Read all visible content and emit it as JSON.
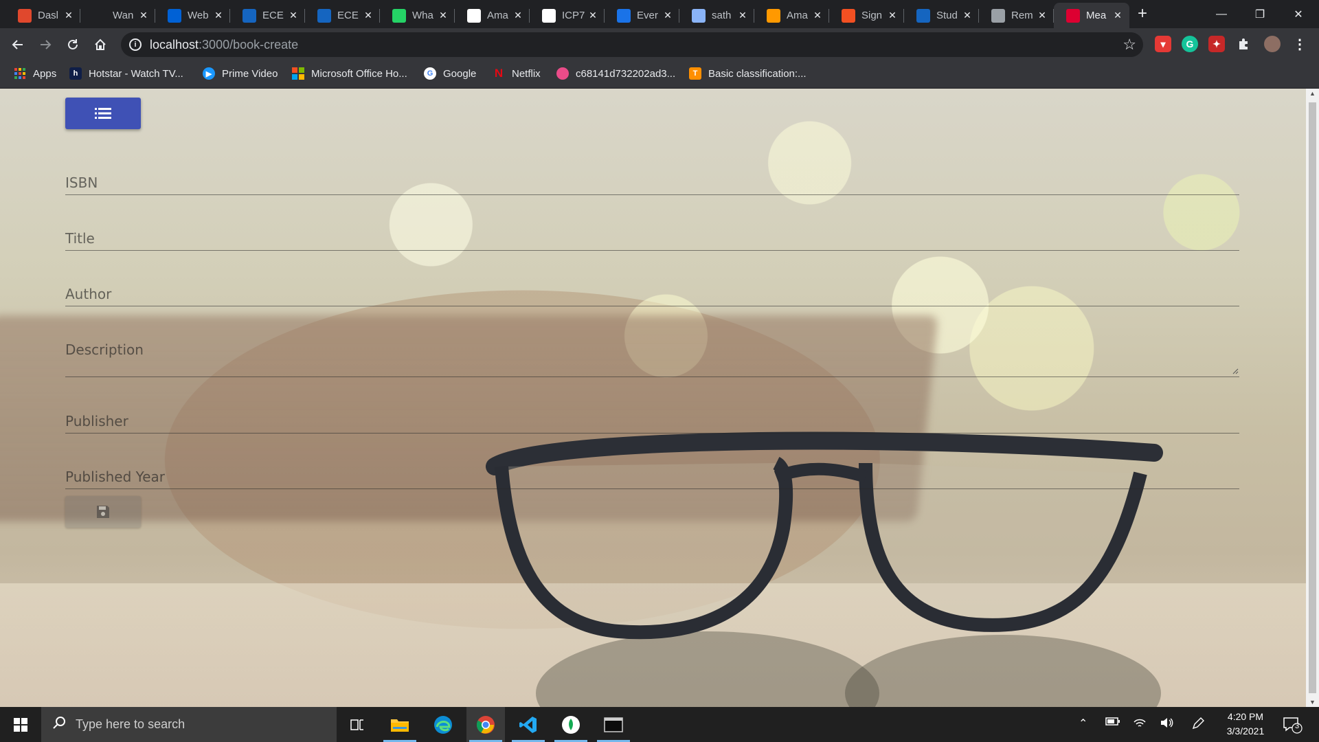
{
  "browser": {
    "tabs": [
      {
        "label": "Dasl",
        "icon": "dashboard-favicon",
        "color": "#e0482d"
      },
      {
        "label": "Wan",
        "icon": "wan-favicon",
        "color": "#202124"
      },
      {
        "label": "Web",
        "icon": "box-favicon",
        "color": "#0061d5"
      },
      {
        "label": "ECE",
        "icon": "ece-favicon",
        "color": "#1565c0"
      },
      {
        "label": "ECE",
        "icon": "ece-favicon",
        "color": "#1565c0"
      },
      {
        "label": "Wha",
        "icon": "whatsapp-favicon",
        "color": "#25d366"
      },
      {
        "label": "Ama",
        "icon": "amazon-favicon",
        "color": "#ffffff"
      },
      {
        "label": "ICP7",
        "icon": "github-favicon",
        "color": "#ffffff"
      },
      {
        "label": "Ever",
        "icon": "ever-favicon",
        "color": "#1a73e8"
      },
      {
        "label": "sath",
        "icon": "sath-favicon",
        "color": "#8ab4f8"
      },
      {
        "label": "Ama",
        "icon": "aws-favicon",
        "color": "#ff9900"
      },
      {
        "label": "Sign",
        "icon": "microsoft-favicon",
        "color": "#f25022"
      },
      {
        "label": "Stud",
        "icon": "ece-favicon",
        "color": "#1565c0"
      },
      {
        "label": "Rem",
        "icon": "globe-favicon",
        "color": "#9aa0a6"
      },
      {
        "label": "Mea",
        "icon": "angular-favicon",
        "color": "#dd0031",
        "active": true
      }
    ],
    "new_tab_glyph": "+",
    "window_controls": {
      "minimize": "—",
      "restore": "❐",
      "close": "✕"
    },
    "address": {
      "host": "localhost",
      "path": ":3000/book-create"
    },
    "bookmarks": [
      {
        "label": "Apps",
        "icon": "apps-grid-icon"
      },
      {
        "label": "Hotstar - Watch TV...",
        "icon": "hotstar-icon"
      },
      {
        "label": "Prime Video",
        "icon": "prime-video-icon"
      },
      {
        "label": "Microsoft Office Ho...",
        "icon": "office-icon"
      },
      {
        "label": "Google",
        "icon": "google-icon"
      },
      {
        "label": "Netflix",
        "icon": "netflix-icon"
      },
      {
        "label": "c68141d732202ad3...",
        "icon": "dribbble-icon"
      },
      {
        "label": "Basic classification:...",
        "icon": "tensorflow-icon"
      }
    ]
  },
  "form": {
    "fields": [
      {
        "label": "ISBN"
      },
      {
        "label": "Title"
      },
      {
        "label": "Author"
      },
      {
        "label": "Description"
      },
      {
        "label": "Publisher"
      },
      {
        "label": "Published Year"
      }
    ],
    "menu_button_icon": "list-icon",
    "save_button_icon": "save-icon",
    "colors": {
      "menu_button": "#3f51b5"
    }
  },
  "taskbar": {
    "search_placeholder": "Type here to search",
    "time": "4:20 PM",
    "date": "3/3/2021",
    "notification_count": "3"
  }
}
